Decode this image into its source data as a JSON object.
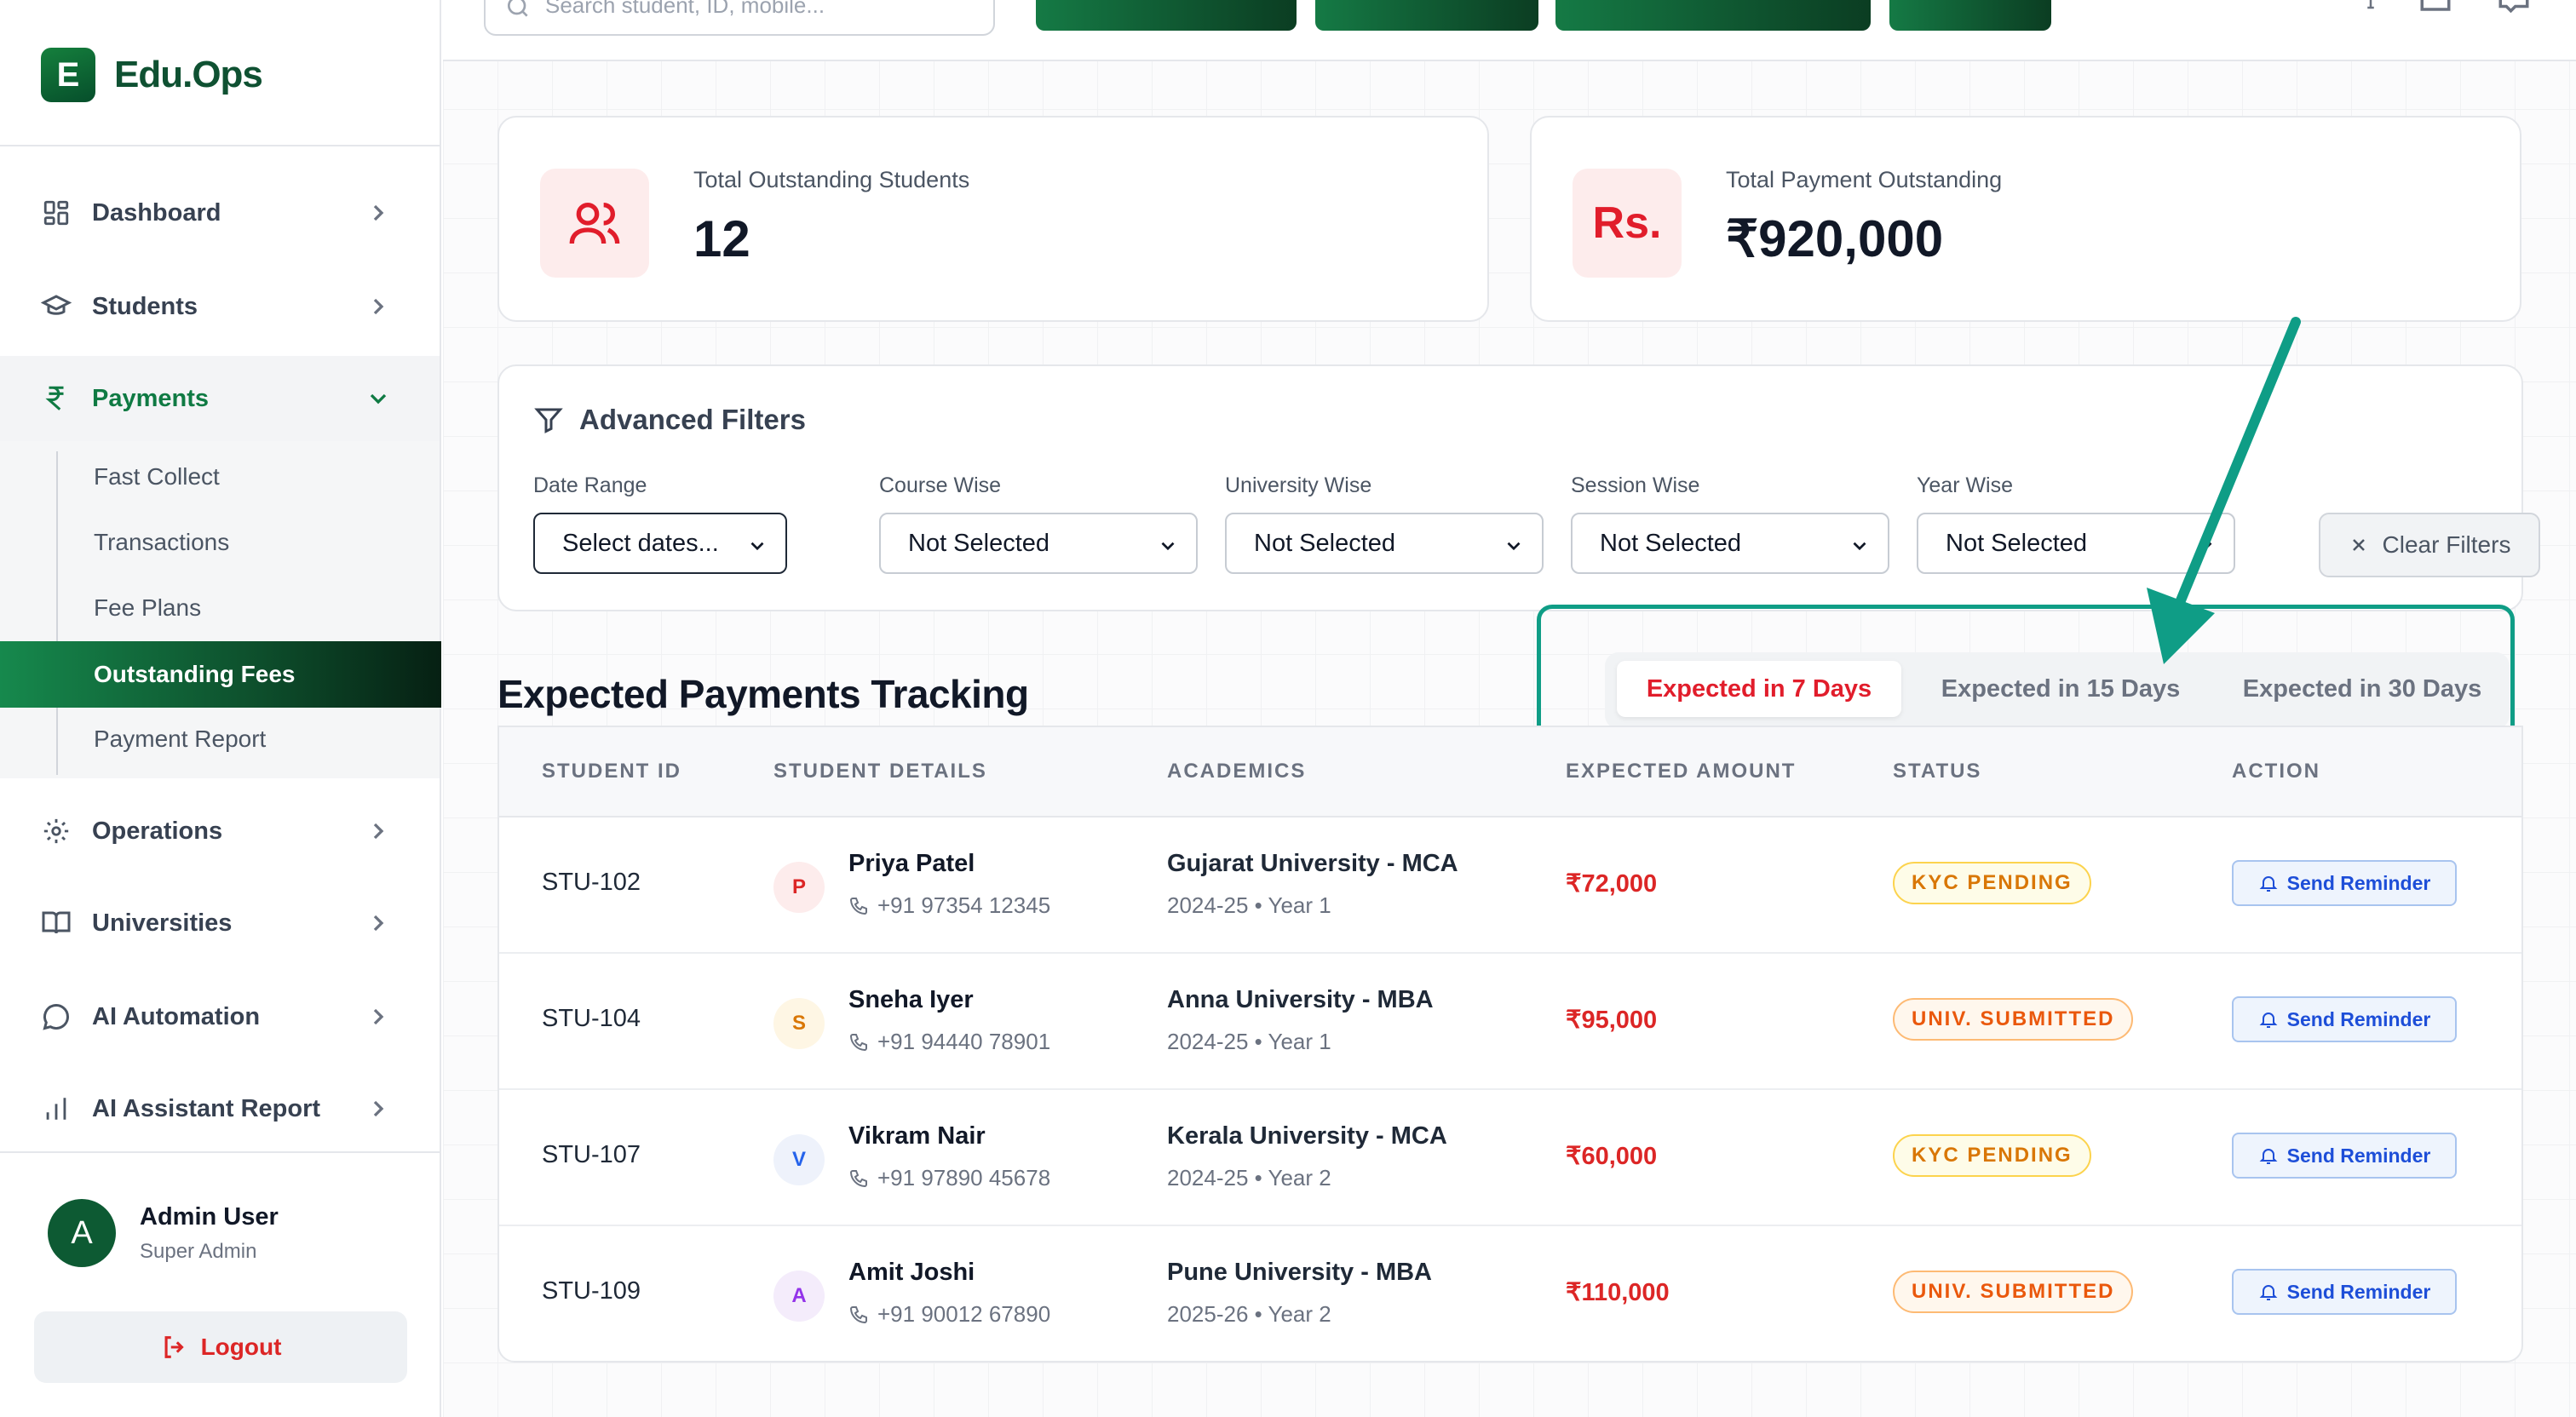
{
  "brand": {
    "letter": "E",
    "name": "Edu.Ops"
  },
  "sidebar": {
    "items": [
      {
        "label": "Dashboard",
        "icon": "grid-icon"
      },
      {
        "label": "Students",
        "icon": "graduation-cap-icon"
      },
      {
        "label": "Payments",
        "icon": "rupee-icon"
      },
      {
        "label": "Operations",
        "icon": "gear-icon"
      },
      {
        "label": "Universities",
        "icon": "book-icon"
      },
      {
        "label": "AI Automation",
        "icon": "chat-bubble-icon"
      },
      {
        "label": "AI Assistant Report",
        "icon": "bar-chart-icon"
      }
    ],
    "payments_submenu": [
      "Fast Collect",
      "Transactions",
      "Fee Plans",
      "Outstanding Fees",
      "Payment Report"
    ],
    "active_submenu": "Outstanding Fees"
  },
  "profile": {
    "initial": "A",
    "name": "Admin User",
    "role": "Super Admin"
  },
  "logout_label": "Logout",
  "topbar": {
    "search_placeholder": "Search student, ID, mobile..."
  },
  "stats": [
    {
      "label": "Total Outstanding Students",
      "value": "12",
      "icon": "users-icon"
    },
    {
      "label": "Total Payment Outstanding",
      "value": "₹920,000",
      "icon_text": "Rs."
    }
  ],
  "filters": {
    "title": "Advanced Filters",
    "fields": [
      {
        "label": "Date Range",
        "value": "Select dates..."
      },
      {
        "label": "Course Wise",
        "value": "Not Selected"
      },
      {
        "label": "University Wise",
        "value": "Not Selected"
      },
      {
        "label": "Session Wise",
        "value": "Not Selected"
      },
      {
        "label": "Year Wise",
        "value": "Not Selected"
      }
    ],
    "clear_label": "Clear Filters"
  },
  "section": {
    "title": "Expected Payments Tracking",
    "tabs": [
      "Expected in 7 Days",
      "Expected in 15 Days",
      "Expected in 30 Days"
    ],
    "active_tab": "Expected in 7 Days"
  },
  "table": {
    "headers": [
      "STUDENT ID",
      "STUDENT DETAILS",
      "ACADEMICS",
      "EXPECTED AMOUNT",
      "STATUS",
      "ACTION"
    ],
    "rows": [
      {
        "id": "STU-102",
        "initial": "P",
        "name": "Priya Patel",
        "phone": "+91 97354 12345",
        "university": "Gujarat University - MCA",
        "session": "2024-25 • Year 1",
        "amount": "₹72,000",
        "status": "KYC PENDING",
        "action": "Send Reminder"
      },
      {
        "id": "STU-104",
        "initial": "S",
        "name": "Sneha Iyer",
        "phone": "+91 94440 78901",
        "university": "Anna University - MBA",
        "session": "2024-25 • Year 1",
        "amount": "₹95,000",
        "status": "UNIV. SUBMITTED",
        "action": "Send Reminder"
      },
      {
        "id": "STU-107",
        "initial": "V",
        "name": "Vikram Nair",
        "phone": "+91 97890 45678",
        "university": "Kerala University - MCA",
        "session": "2024-25 • Year 2",
        "amount": "₹60,000",
        "status": "KYC PENDING",
        "action": "Send Reminder"
      },
      {
        "id": "STU-109",
        "initial": "A",
        "name": "Amit Joshi",
        "phone": "+91 90012 67890",
        "university": "Pune University - MBA",
        "session": "2025-26 • Year 2",
        "amount": "₹110,000",
        "status": "UNIV. SUBMITTED",
        "action": "Send Reminder"
      }
    ]
  },
  "colors": {
    "brand_green": "#0f7a43",
    "danger_red": "#dc2626",
    "highlight_teal": "#0f9d86",
    "link_blue": "#1d4ed8"
  }
}
